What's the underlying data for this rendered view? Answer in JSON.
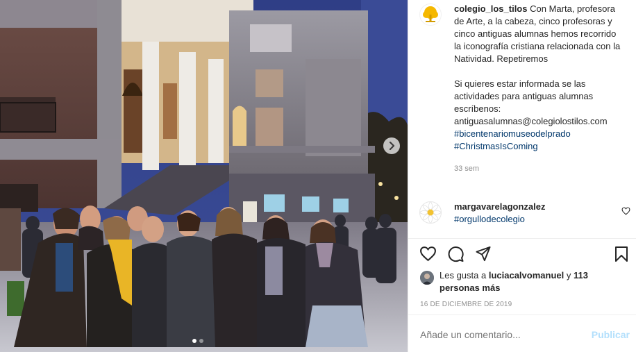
{
  "post": {
    "author": "colegio_los_tilos",
    "caption_paragraph_1": "Con Marta, profesora de Arte, a la cabeza, cinco profesoras y cinco antiguas alumnas hemos recorrido la iconografía cristiana relacionada con la Natividad. Repetiremos",
    "caption_paragraph_2": "Si quieres estar informada se las actividades para antiguas alumnas escríbenos: antiguasalumnas@colegiolostilos.com",
    "hashtags": [
      "#bicentenariomuseodelprado",
      "#ChristmasIsComing"
    ],
    "time_ago": "33 sem",
    "avatar_icon": "tree-logo-icon",
    "brand_color": "#f5b800"
  },
  "comment": {
    "author": "margavarelagonzalez",
    "text": "#orgullodecolegio",
    "avatar_icon": "daisy-icon"
  },
  "likes": {
    "prefix": "Les gusta a",
    "first_user": "luciacalvomanuel",
    "connector": "y",
    "others": "113 personas más"
  },
  "date": "16 DE DICIEMBRE DE 2019",
  "add_comment": {
    "placeholder": "Añade un comentario...",
    "publish_label": "Publicar"
  },
  "carousel": {
    "total_slides": 2,
    "current_slide": 1
  },
  "colors": {
    "link": "#00376b",
    "meta": "#8e8e8e",
    "publish_disabled": "#b2dffc",
    "text": "#262626"
  }
}
